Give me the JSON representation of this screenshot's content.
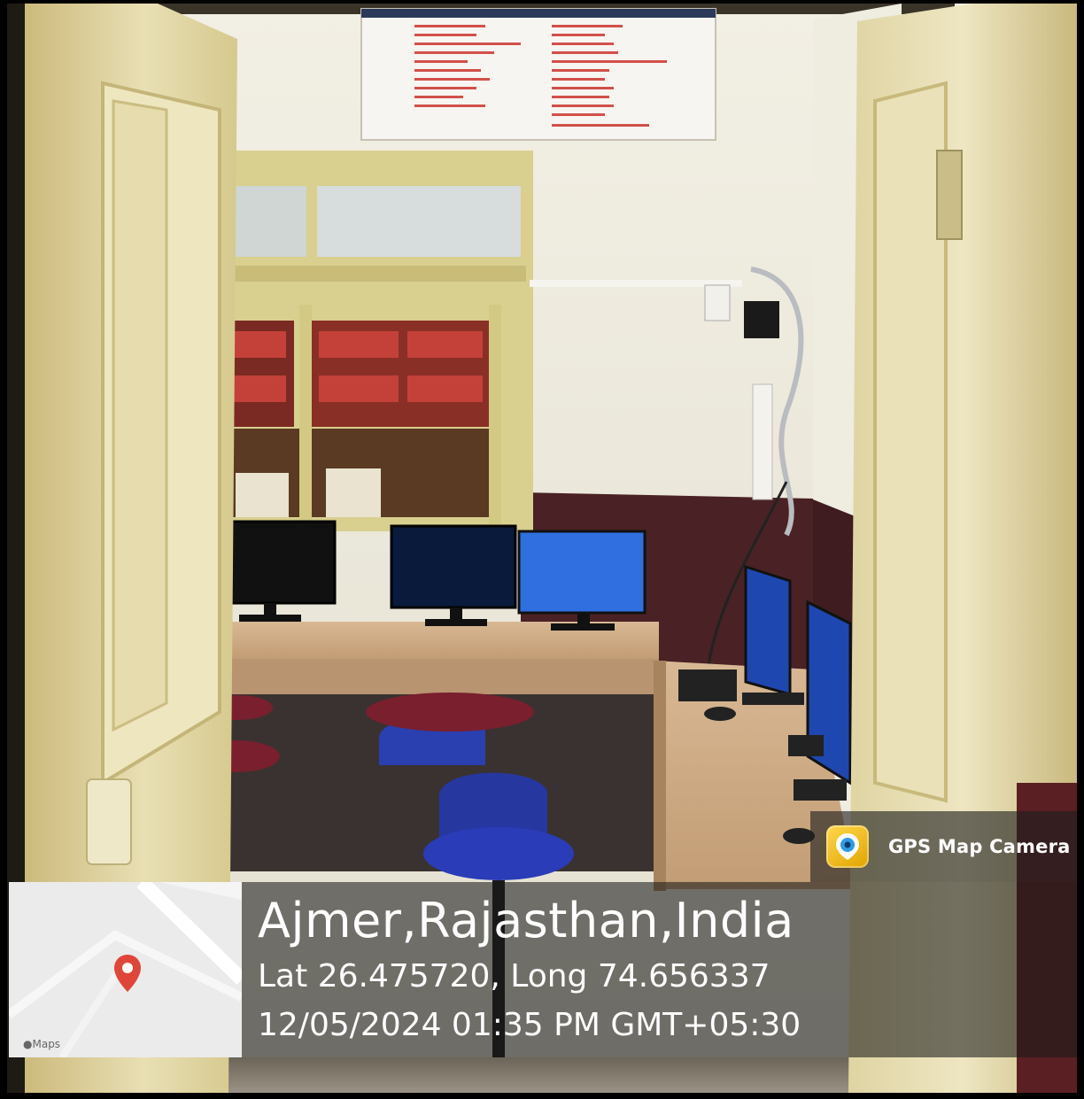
{
  "photo": {
    "subject": "library-computer-room-doorway"
  },
  "overlay": {
    "location": "Ajmer,Rajasthan,India",
    "lat_label": "Lat",
    "lat_value": "26.475720,",
    "long_label": "Long",
    "long_value": "74.656337",
    "datetime": "12/05/2024 01:35 PM GMT+05:30",
    "app_name": "GPS Map Camera",
    "map_brand": "Maps"
  },
  "colors": {
    "pin": "#e0453a",
    "overlay_bg": "#191919",
    "door": "#e6dcae",
    "wall": "#ecebdf",
    "wainscot": "#4a2124",
    "monitor_screen_blue": "#2f6fe0"
  },
  "icons": [
    "map-pin-icon",
    "gps-map-camera-logo-icon",
    "apple-logo-icon"
  ]
}
